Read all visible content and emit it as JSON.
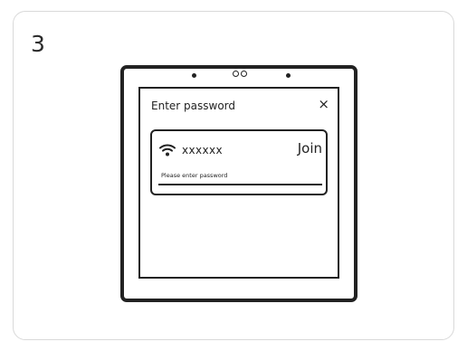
{
  "step": {
    "number": "3"
  },
  "dialog": {
    "title": "Enter password",
    "close_symbol": "×"
  },
  "network": {
    "name": "xxxxxx",
    "join_label": "Join",
    "password_placeholder": "Please enter password",
    "icon": "wifi-icon"
  },
  "colors": {
    "stroke": "#222222",
    "background": "#ffffff",
    "card_border": "#d9d9d9"
  }
}
